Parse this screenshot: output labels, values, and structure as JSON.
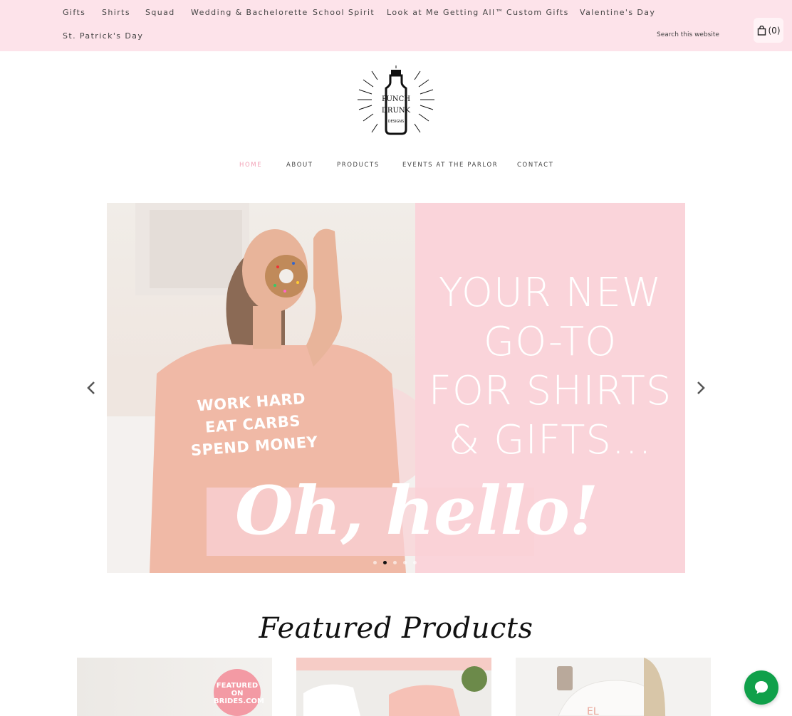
{
  "topbar": {
    "categories": [
      "Gifts",
      "Shirts",
      "Squad",
      "Wedding & Bachelorette",
      "School Spirit",
      "Look at Me Getting All™",
      "Custom Gifts",
      "Valentine's Day",
      "St. Patrick's Day"
    ],
    "search_placeholder": "Search this website",
    "cart_count": "(0)"
  },
  "logo": {
    "text_lines": [
      "PUNCH",
      "DRUNK",
      "DESIGNS"
    ],
    "icon": "bottle-logo-icon"
  },
  "nav": {
    "items": [
      "HOME",
      "ABOUT",
      "PRODUCTS",
      "EVENTS AT THE PARLOR",
      "CONTACT"
    ],
    "active": "HOME"
  },
  "hero": {
    "headline_lines": [
      "YOUR NEW",
      "GO-TO",
      "FOR SHIRTS",
      "& GIFTS..."
    ],
    "script_text": "Oh, hello!",
    "shirt_lines": [
      "WORK HARD",
      "EAT CARBS",
      "SPEND MONEY"
    ],
    "slide_count": 5,
    "active_slide": 2,
    "prev_icon": "chevron-left-icon",
    "next_icon": "chevron-right-icon"
  },
  "featured": {
    "title": "Featured Products",
    "badge_lines": [
      "FEATURED",
      "ON",
      "BRIDES.COM"
    ]
  },
  "colors": {
    "topbar_bg": "#fde3ea",
    "accent_pink": "#f2a0b5",
    "hero_pink": "#fad4da",
    "chat_green": "#10a04a"
  },
  "chat": {
    "icon": "chat-bubble-icon"
  }
}
